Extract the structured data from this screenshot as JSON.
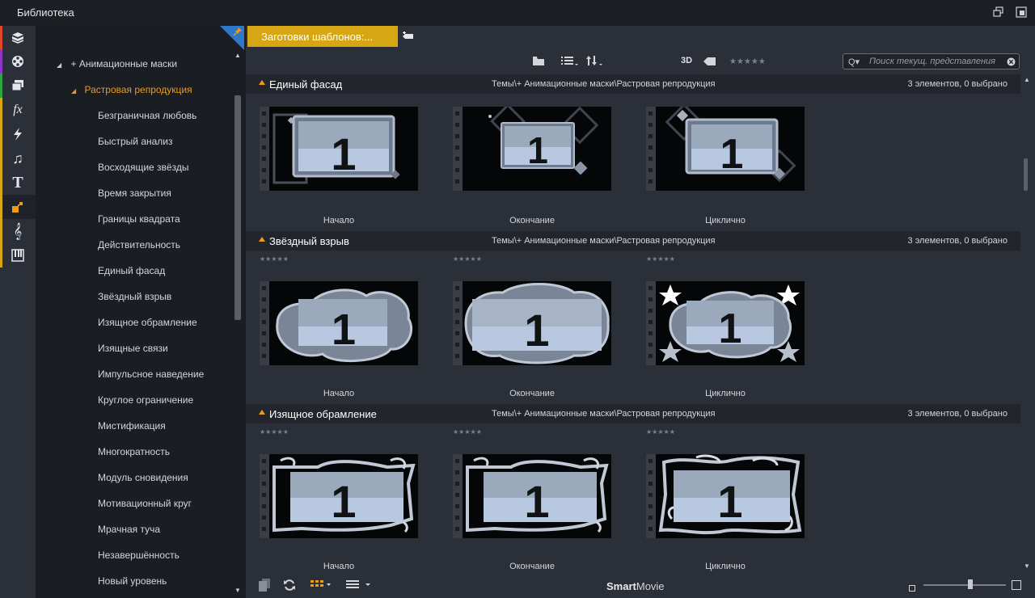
{
  "window": {
    "title": "Библиотека"
  },
  "tree": {
    "parent": "+ Анимационные маски",
    "selected": "Растровая репродукция",
    "items": [
      "Безграничная любовь",
      "Быстрый анализ",
      "Восходящие звёзды",
      "Время закрытия",
      "Границы квадрата",
      "Действительность",
      "Единый фасад",
      "Звёздный взрыв",
      "Изящное обрамление",
      "Изящные связи",
      "Импульсное наведение",
      "Круглое ограничение",
      "Мистификация",
      "Многократность",
      "Модуль сновидения",
      "Мотивационный круг",
      "Мрачная туча",
      "Незавершённость",
      "Новый уровень"
    ]
  },
  "tab": {
    "label": "Заготовки шаблонов:..."
  },
  "toolbar": {
    "three_d": "3D",
    "search_placeholder": "Поиск текущ. представления",
    "rating_stars": "★★★★★"
  },
  "sections": [
    {
      "name": "Единый фасад",
      "path": "Темы\\+ Анимационные маски\\Растровая репродукция",
      "count": "3 элементов, 0 выбрано",
      "items": [
        {
          "caption": "Начало",
          "style": "facade",
          "number": "1"
        },
        {
          "caption": "Окончание",
          "style": "facade2",
          "number": "1"
        },
        {
          "caption": "Циклично",
          "style": "facade3",
          "number": "1"
        }
      ]
    },
    {
      "name": "Звёздный взрыв",
      "path": "Темы\\+ Анимационные маски\\Растровая репродукция",
      "count": "3 элементов, 0 выбрано",
      "items": [
        {
          "caption": "Начало",
          "style": "cloud",
          "number": "1"
        },
        {
          "caption": "Окончание",
          "style": "cloud2",
          "number": "1"
        },
        {
          "caption": "Циклично",
          "style": "cloud3",
          "number": "1"
        }
      ]
    },
    {
      "name": "Изящное обрамление",
      "path": "Темы\\+ Анимационные маски\\Растровая репродукция",
      "count": "3 элементов, 0 выбрано",
      "items": [
        {
          "caption": "Начало",
          "style": "ornate",
          "number": "1"
        },
        {
          "caption": "Окончание",
          "style": "ornate",
          "number": "1"
        },
        {
          "caption": "Циклично",
          "style": "ornate2",
          "number": "1"
        }
      ]
    }
  ],
  "item_stars": "★★★★★",
  "bottom": {
    "brand_bold": "Smart",
    "brand_rest": "Movie"
  },
  "colors": {
    "accent": "#f09a17",
    "tab": "#d6a615",
    "corner": "#2f78c8"
  }
}
